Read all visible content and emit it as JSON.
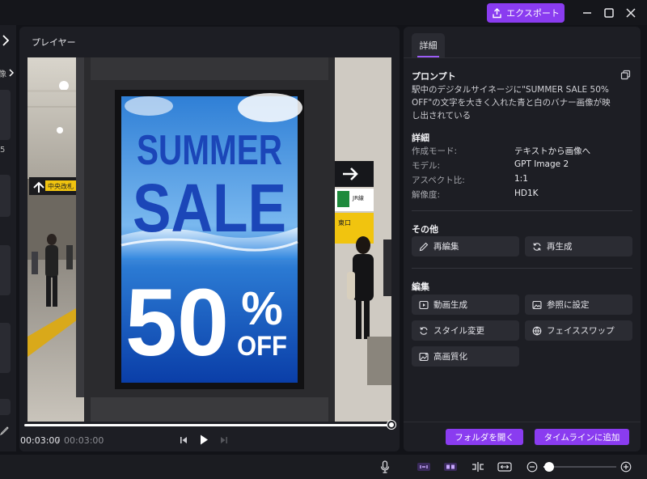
{
  "titlebar": {
    "export_label": "エクスポート",
    "export_icon": "export-icon",
    "controls": [
      "minimize-icon",
      "maximize-icon",
      "close-icon"
    ]
  },
  "left_strip": {
    "label_fragment": "像",
    "count_fragment": "5"
  },
  "player": {
    "title": "プレイヤー",
    "current_time": "00:03:00",
    "separator": "/",
    "total_time": "00:03:00",
    "progress": 1.0,
    "sign": {
      "line1": "SUMMER",
      "line2": "SALE",
      "percent_number": "50",
      "percent_symbol": "%",
      "off": "OFF"
    },
    "station_signs": {
      "left": "中央改札",
      "right_top": "JR線",
      "right_bottom": "東口"
    }
  },
  "details": {
    "tab_label": "詳細",
    "prompt_title": "プロンプト",
    "prompt_text": "駅中のデジタルサイネージに\"SUMMER SALE 50% OFF\"の文字を大きく入れた青と白のバナー画像が映し出されている",
    "info_title": "詳細",
    "info": [
      {
        "key": "作成モード:",
        "value": "テキストから画像へ"
      },
      {
        "key": "モデル:",
        "value": "GPT Image 2"
      },
      {
        "key": "アスペクト比:",
        "value": "1:1"
      },
      {
        "key": "解像度:",
        "value": "HD1K"
      }
    ],
    "other_title": "その他",
    "other_actions": [
      {
        "label": "再編集",
        "icon": "pencil-icon"
      },
      {
        "label": "再生成",
        "icon": "refresh-icon"
      }
    ],
    "edit_title": "編集",
    "edit_actions": [
      {
        "label": "動画生成",
        "icon": "video-icon"
      },
      {
        "label": "参照に設定",
        "icon": "image-reference-icon"
      },
      {
        "label": "スタイル変更",
        "icon": "style-refresh-icon"
      },
      {
        "label": "フェイススワップ",
        "icon": "face-swap-icon"
      },
      {
        "label": "高画質化",
        "icon": "enhance-icon"
      }
    ],
    "open_folder_label": "フォルダを開く",
    "add_timeline_label": "タイムラインに追加"
  },
  "bottom_toolbar": {
    "icons": [
      "microphone-icon",
      "link-icon",
      "split-view-icon",
      "trim-icon",
      "fit-width-icon",
      "zoom-out-icon",
      "zoom-in-icon"
    ],
    "zoom_level": 0.08
  }
}
